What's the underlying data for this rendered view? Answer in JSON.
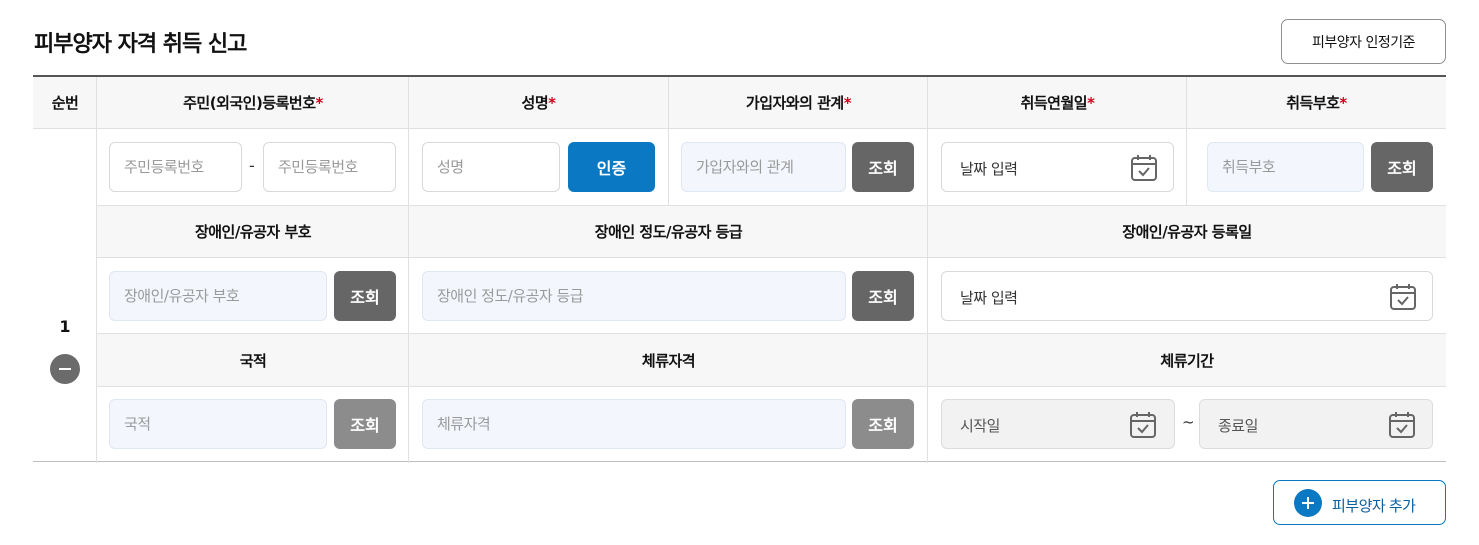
{
  "page": {
    "title": "피부양자 자격 취득 신고",
    "criteria_button": "피부양자 인정기준",
    "add_button": "피부양자 추가"
  },
  "table": {
    "headers_row1": {
      "seq": "순번",
      "rrn": "주민(외국인)등록번호",
      "name": "성명",
      "relation": "가입자와의 관계",
      "acq_date": "취득연월일",
      "acq_code": "취득부호",
      "required_mark": "*"
    },
    "headers_row2": {
      "disability_code": "장애인/유공자 부호",
      "disability_grade": "장애인 정도/유공자 등급",
      "disability_reg_date": "장애인/유공자 등록일"
    },
    "headers_row3": {
      "nationality": "국적",
      "stay_status": "체류자격",
      "stay_period": "체류기간"
    },
    "row": {
      "seq": "1",
      "rrn_front_placeholder": "주민등록번호",
      "rrn_sep": "-",
      "rrn_back_placeholder": "주민등록번호",
      "name_placeholder": "성명",
      "verify_button": "인증",
      "relation_placeholder": "가입자와의 관계",
      "lookup_button": "조회",
      "date_placeholder": "날짜 입력",
      "acq_code_placeholder": "취득부호",
      "disability_code_placeholder": "장애인/유공자 부호",
      "disability_grade_placeholder": "장애인 정도/유공자 등급",
      "nationality_placeholder": "국적",
      "stay_status_placeholder": "체류자격",
      "start_date_placeholder": "시작일",
      "range_sep": "~",
      "end_date_placeholder": "종료일"
    }
  },
  "colors": {
    "primary": "#0a78c2",
    "required": "#d0021b",
    "button_dark": "#666666",
    "button_disabled": "#8c8c8c",
    "header_bg": "#f7f7f7",
    "readonly_input_bg": "#f3f7fd"
  },
  "icons": {
    "calendar": "calendar-check-icon",
    "remove": "minus-circle-icon",
    "add": "plus-circle-icon"
  }
}
